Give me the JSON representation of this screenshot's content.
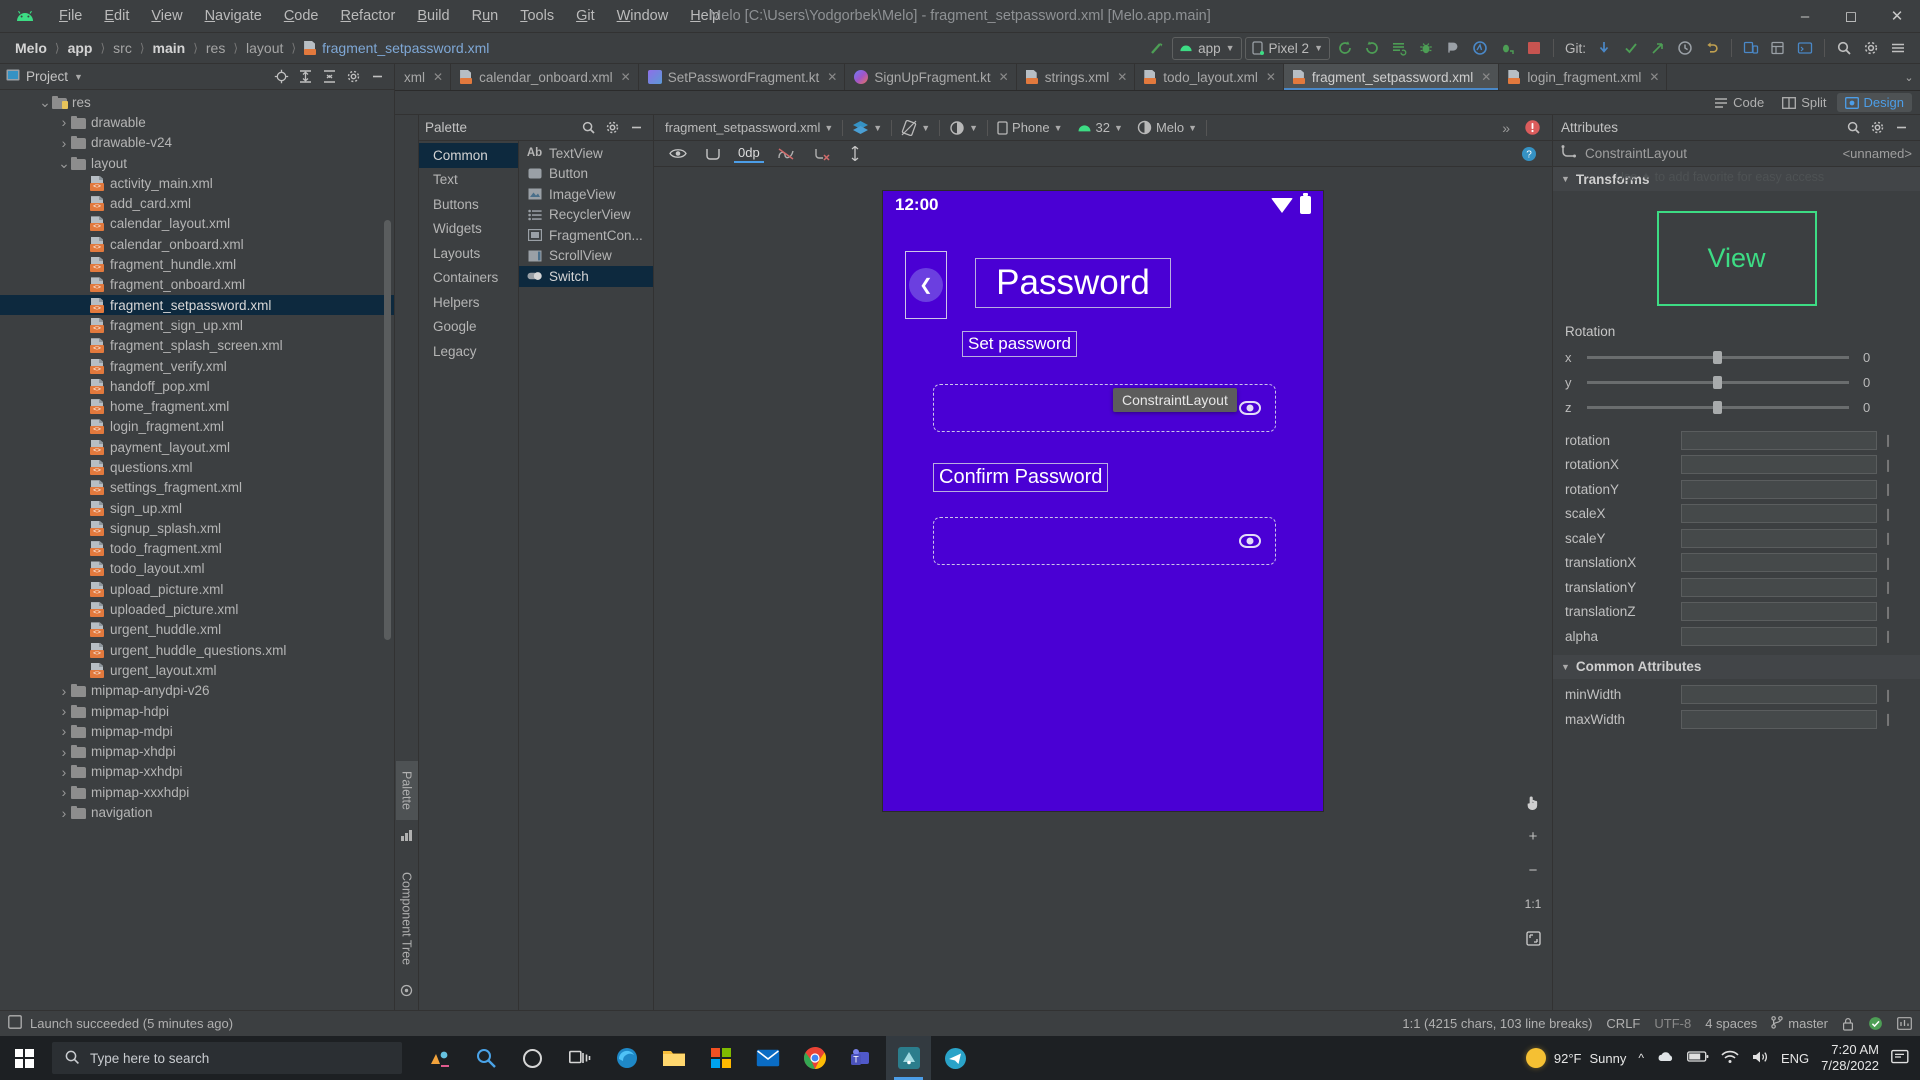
{
  "titlebar": {
    "logo_icon": "android-logo-icon",
    "menus": [
      "File",
      "Edit",
      "View",
      "Navigate",
      "Code",
      "Refactor",
      "Build",
      "Run",
      "Tools",
      "Git",
      "Window",
      "Help"
    ],
    "window_title": "Melo [C:\\Users\\Yodgorbek\\Melo] - fragment_setpassword.xml [Melo.app.main]",
    "minimize_icon": "minimize-icon",
    "maximize_icon": "maximize-icon",
    "close_icon": "close-icon"
  },
  "navbar": {
    "breadcrumbs": [
      "Melo",
      "app",
      "src",
      "main",
      "res",
      "layout",
      "fragment_setpassword.xml"
    ],
    "run_config": "app",
    "device": "Pixel 2",
    "git_label": "Git:",
    "icons": [
      "make-project-icon",
      "sync-gradle-icon",
      "sync-gradle-2-icon",
      "avd-manager-icon",
      "debug-icon",
      "profiler-icon",
      "attach-debugger-icon",
      "stop-icon",
      "git-update-icon",
      "git-commit-icon",
      "git-push-icon",
      "history-icon",
      "undo-icon",
      "device-manager-icon",
      "layout-inspector-icon",
      "logcat-icon",
      "search-icon",
      "settings-icon",
      "menu-icon"
    ]
  },
  "project_panel": {
    "title": "Project",
    "head_icons": [
      "locate-icon",
      "expand-all-icon",
      "collapse-all-icon",
      "settings-icon",
      "hide-icon"
    ],
    "tree": [
      {
        "label": "res",
        "indent": 2,
        "type": "folder-res",
        "arrow": "down"
      },
      {
        "label": "drawable",
        "indent": 3,
        "type": "folder",
        "arrow": "right"
      },
      {
        "label": "drawable-v24",
        "indent": 3,
        "type": "folder",
        "arrow": "right"
      },
      {
        "label": "layout",
        "indent": 3,
        "type": "folder",
        "arrow": "down"
      },
      {
        "label": "activity_main.xml",
        "indent": 4,
        "type": "xml",
        "arrow": "none"
      },
      {
        "label": "add_card.xml",
        "indent": 4,
        "type": "xml",
        "arrow": "none"
      },
      {
        "label": "calendar_layout.xml",
        "indent": 4,
        "type": "xml",
        "arrow": "none"
      },
      {
        "label": "calendar_onboard.xml",
        "indent": 4,
        "type": "xml",
        "arrow": "none"
      },
      {
        "label": "fragment_hundle.xml",
        "indent": 4,
        "type": "xml",
        "arrow": "none"
      },
      {
        "label": "fragment_onboard.xml",
        "indent": 4,
        "type": "xml",
        "arrow": "none"
      },
      {
        "label": "fragment_setpassword.xml",
        "indent": 4,
        "type": "xml",
        "arrow": "none",
        "selected": true
      },
      {
        "label": "fragment_sign_up.xml",
        "indent": 4,
        "type": "xml",
        "arrow": "none"
      },
      {
        "label": "fragment_splash_screen.xml",
        "indent": 4,
        "type": "xml",
        "arrow": "none"
      },
      {
        "label": "fragment_verify.xml",
        "indent": 4,
        "type": "xml",
        "arrow": "none"
      },
      {
        "label": "handoff_pop.xml",
        "indent": 4,
        "type": "xml",
        "arrow": "none"
      },
      {
        "label": "home_fragment.xml",
        "indent": 4,
        "type": "xml",
        "arrow": "none"
      },
      {
        "label": "login_fragment.xml",
        "indent": 4,
        "type": "xml",
        "arrow": "none"
      },
      {
        "label": "payment_layout.xml",
        "indent": 4,
        "type": "xml",
        "arrow": "none"
      },
      {
        "label": "questions.xml",
        "indent": 4,
        "type": "xml",
        "arrow": "none"
      },
      {
        "label": "settings_fragment.xml",
        "indent": 4,
        "type": "xml",
        "arrow": "none"
      },
      {
        "label": "sign_up.xml",
        "indent": 4,
        "type": "xml",
        "arrow": "none"
      },
      {
        "label": "signup_splash.xml",
        "indent": 4,
        "type": "xml",
        "arrow": "none"
      },
      {
        "label": "todo_fragment.xml",
        "indent": 4,
        "type": "xml",
        "arrow": "none"
      },
      {
        "label": "todo_layout.xml",
        "indent": 4,
        "type": "xml",
        "arrow": "none"
      },
      {
        "label": "upload_picture.xml",
        "indent": 4,
        "type": "xml",
        "arrow": "none"
      },
      {
        "label": "uploaded_picture.xml",
        "indent": 4,
        "type": "xml",
        "arrow": "none"
      },
      {
        "label": "urgent_huddle.xml",
        "indent": 4,
        "type": "xml",
        "arrow": "none"
      },
      {
        "label": "urgent_huddle_questions.xml",
        "indent": 4,
        "type": "xml",
        "arrow": "none"
      },
      {
        "label": "urgent_layout.xml",
        "indent": 4,
        "type": "xml",
        "arrow": "none"
      },
      {
        "label": "mipmap-anydpi-v26",
        "indent": 3,
        "type": "folder",
        "arrow": "right"
      },
      {
        "label": "mipmap-hdpi",
        "indent": 3,
        "type": "folder",
        "arrow": "right"
      },
      {
        "label": "mipmap-mdpi",
        "indent": 3,
        "type": "folder",
        "arrow": "right"
      },
      {
        "label": "mipmap-xhdpi",
        "indent": 3,
        "type": "folder",
        "arrow": "right"
      },
      {
        "label": "mipmap-xxhdpi",
        "indent": 3,
        "type": "folder",
        "arrow": "right"
      },
      {
        "label": "mipmap-xxxhdpi",
        "indent": 3,
        "type": "folder",
        "arrow": "right"
      },
      {
        "label": "navigation",
        "indent": 3,
        "type": "folder",
        "arrow": "right"
      }
    ]
  },
  "editor_tabs": [
    {
      "label": "xml",
      "icon": "xml-file-icon",
      "active": false,
      "truncated": true
    },
    {
      "label": "calendar_onboard.xml",
      "icon": "xml-file-icon",
      "active": false
    },
    {
      "label": "SetPasswordFragment.kt",
      "icon": "kotlin-file-icon",
      "active": false
    },
    {
      "label": "SignUpFragment.kt",
      "icon": "kotlin-circle-icon",
      "active": false
    },
    {
      "label": "strings.xml",
      "icon": "xml-file-icon",
      "active": false
    },
    {
      "label": "todo_layout.xml",
      "icon": "xml-file-icon",
      "active": false
    },
    {
      "label": "fragment_setpassword.xml",
      "icon": "xml-file-icon",
      "active": true
    },
    {
      "label": "login_fragment.xml",
      "icon": "xml-file-icon",
      "active": false
    }
  ],
  "mode_switch": [
    {
      "label": "Code",
      "icon": "code-mode-icon",
      "active": false
    },
    {
      "label": "Split",
      "icon": "split-mode-icon",
      "active": false
    },
    {
      "label": "Design",
      "icon": "design-mode-icon",
      "active": true
    }
  ],
  "palette": {
    "title": "Palette",
    "search_icon": "search-icon",
    "settings_icon": "gear-icon",
    "minimize_icon": "minimize-icon",
    "categories": [
      "Common",
      "Text",
      "Buttons",
      "Widgets",
      "Layouts",
      "Containers",
      "Helpers",
      "Google",
      "Legacy"
    ],
    "selected_category": "Common",
    "items": [
      {
        "label": "TextView",
        "icon": "textview-icon"
      },
      {
        "label": "Button",
        "icon": "button-icon"
      },
      {
        "label": "ImageView",
        "icon": "imageview-icon"
      },
      {
        "label": "RecyclerView",
        "icon": "recyclerview-icon"
      },
      {
        "label": "FragmentCon...",
        "icon": "fragment-container-icon"
      },
      {
        "label": "ScrollView",
        "icon": "scrollview-icon"
      },
      {
        "label": "Switch",
        "icon": "switch-icon",
        "selected": true
      }
    ]
  },
  "vertical_tabs": [
    {
      "label": "Palette",
      "active": true
    },
    {
      "label": "Component Tree",
      "active": false
    }
  ],
  "design_toolbar": {
    "file_name": "fragment_setpassword.xml",
    "layers_icon": "layers-icon",
    "orientation_icon": "rotate-device-icon",
    "theme_icon": "theme-contrast-icon",
    "device": "Phone",
    "api_level": "32",
    "theme": "Melo",
    "overflow_icon": "chevron-double-right-icon",
    "error_icon": "error-badge-icon",
    "row2": {
      "eye_icon": "visibility-icon",
      "constraints_icon": "show-constraints-icon",
      "dp_value": "0dp",
      "autoconnect_icon": "autoconnect-off-icon",
      "clear_constraints_icon": "clear-constraints-icon",
      "margin_icon": "default-margin-icon",
      "help_icon": "help-icon"
    }
  },
  "preview": {
    "status_time": "12:00",
    "wifi_icon": "wifi-icon",
    "battery_icon": "battery-icon",
    "back_icon": "back-arrow-icon",
    "title": "Password",
    "subtitle": "Set password",
    "tooltip": "ConstraintLayout",
    "confirm_label": "Confirm Password",
    "eye_icon": "eye-icon",
    "background_color": "#4a00d4",
    "zoom_controls": [
      "pan-icon",
      "zoom-in-icon",
      "zoom-out-icon",
      "zoom-actual-icon",
      "zoom-fit-icon"
    ],
    "zoom_actual_label": "1:1"
  },
  "attributes": {
    "title": "Attributes",
    "search_icon": "search-icon",
    "settings_icon": "gear-icon",
    "minimize_icon": "minimize-icon",
    "component_icon": "constraint-layout-icon",
    "component_type": "ConstraintLayout",
    "component_id": "<unnamed>",
    "faint_note": "Use ✦ to add favorite for easy access",
    "transforms_section": "Transforms",
    "view_box_label": "View",
    "rotation_label": "Rotation",
    "rotation_axes": [
      {
        "axis": "x",
        "value": "0"
      },
      {
        "axis": "y",
        "value": "0"
      },
      {
        "axis": "z",
        "value": "0"
      }
    ],
    "properties": [
      {
        "name": "rotation",
        "value": ""
      },
      {
        "name": "rotationX",
        "value": ""
      },
      {
        "name": "rotationY",
        "value": ""
      },
      {
        "name": "scaleX",
        "value": ""
      },
      {
        "name": "scaleY",
        "value": ""
      },
      {
        "name": "translationX",
        "value": ""
      },
      {
        "name": "translationY",
        "value": ""
      },
      {
        "name": "translationZ",
        "value": ""
      },
      {
        "name": "alpha",
        "value": ""
      }
    ],
    "common_section": "Common Attributes",
    "common_properties": [
      {
        "name": "minWidth",
        "value": ""
      },
      {
        "name": "maxWidth",
        "value": ""
      }
    ]
  },
  "statusbar": {
    "launch_icon": "build-status-icon",
    "message": "Launch succeeded (5 minutes ago)",
    "caret_info": "1:1 (4215 chars, 103 line breaks)",
    "line_sep": "CRLF",
    "encoding": "UTF-8",
    "indent": "4 spaces",
    "branch_icon": "git-branch-icon",
    "branch": "master",
    "lock_icon": "lock-icon",
    "event_icon": "event-log-icon",
    "memory_icon": "memory-indicator-icon"
  },
  "taskbar": {
    "start_icon": "windows-start-icon",
    "search_placeholder": "Type here to search",
    "search_icon": "search-icon",
    "apps": [
      {
        "name": "cortana-icon"
      },
      {
        "name": "task-view-icon"
      },
      {
        "name": "edge-icon"
      },
      {
        "name": "file-explorer-icon"
      },
      {
        "name": "microsoft-store-icon"
      },
      {
        "name": "mail-icon"
      },
      {
        "name": "chrome-icon"
      },
      {
        "name": "teams-icon"
      },
      {
        "name": "android-studio-icon",
        "active": true
      },
      {
        "name": "telegram-icon"
      }
    ],
    "weather_temp": "92°F",
    "weather_desc": "Sunny",
    "weather_icon": "sun-icon",
    "tray_icons": [
      "chevron-up-icon",
      "onedrive-icon",
      "battery-icon",
      "wifi-icon",
      "volume-icon"
    ],
    "language": "ENG",
    "time": "7:20 AM",
    "date": "7/28/2022",
    "notification_icon": "notification-icon"
  }
}
